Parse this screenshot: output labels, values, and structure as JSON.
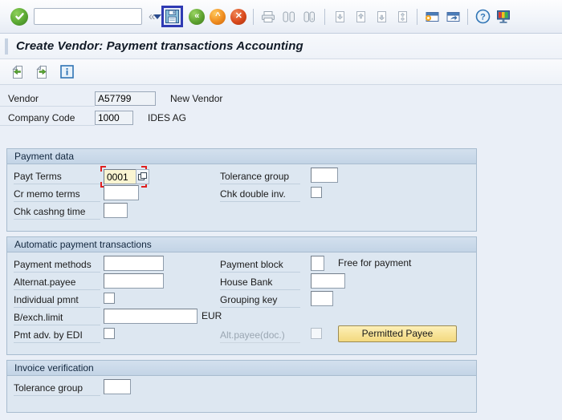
{
  "toolbar": {
    "ok_icon": "check-circle-icon",
    "command_value": "",
    "command_placeholder": "",
    "buttons": [
      {
        "name": "collapse-chevron-icon",
        "label": "«"
      },
      {
        "name": "save-icon",
        "label": "Save"
      },
      {
        "name": "back-icon",
        "label": "«"
      },
      {
        "name": "exit-icon",
        "label": "^"
      },
      {
        "name": "cancel-icon",
        "label": "×"
      },
      {
        "name": "print-icon",
        "label": "Print"
      },
      {
        "name": "find-icon",
        "label": "Find"
      },
      {
        "name": "find-next-icon",
        "label": "Find Next"
      },
      {
        "name": "first-page-icon",
        "label": "First Page"
      },
      {
        "name": "previous-page-icon",
        "label": "Previous Page"
      },
      {
        "name": "next-page-icon",
        "label": "Next Page"
      },
      {
        "name": "last-page-icon",
        "label": "Last Page"
      },
      {
        "name": "create-session-icon",
        "label": "Create Session"
      },
      {
        "name": "create-shortcut-icon",
        "label": "Create Shortcut"
      },
      {
        "name": "help-icon",
        "label": "Help"
      },
      {
        "name": "customize-layout-icon",
        "label": "Customize Local Layout"
      }
    ]
  },
  "title": "Create Vendor: Payment transactions Accounting",
  "app_toolbar": [
    {
      "name": "previous-screen-icon",
      "label": "Previous screen"
    },
    {
      "name": "next-screen-icon",
      "label": "Next screen"
    },
    {
      "name": "info-icon",
      "label": "Info"
    }
  ],
  "header": {
    "vendor_label": "Vendor",
    "vendor_value": "A57799",
    "vendor_desc": "New Vendor",
    "company_code_label": "Company Code",
    "company_code_value": "1000",
    "company_desc": "IDES AG"
  },
  "payment_data": {
    "title": "Payment data",
    "payt_terms_label": "Payt Terms",
    "payt_terms_value": "0001",
    "cr_memo_terms_label": "Cr memo terms",
    "cr_memo_terms_value": "",
    "chk_cashng_time_label": "Chk cashng time",
    "chk_cashng_time_value": "",
    "tolerance_group_label": "Tolerance group",
    "tolerance_group_value": "",
    "chk_double_inv_label": "Chk double inv.",
    "chk_double_inv_checked": false
  },
  "automatic_payment": {
    "title": "Automatic payment transactions",
    "payment_methods_label": "Payment methods",
    "payment_methods_value": "",
    "alternat_payee_label": "Alternat.payee",
    "alternat_payee_value": "",
    "individual_pmnt_label": "Individual pmnt",
    "individual_pmnt_checked": false,
    "bexch_limit_label": "B/exch.limit",
    "bexch_limit_value": "",
    "currency": "EUR",
    "pmt_adv_edi_label": "Pmt adv. by EDI",
    "pmt_adv_edi_checked": false,
    "payment_block_label": "Payment block",
    "payment_block_value": "",
    "payment_block_desc": "Free for payment",
    "house_bank_label": "House Bank",
    "house_bank_value": "",
    "grouping_key_label": "Grouping key",
    "grouping_key_value": "",
    "alt_payee_doc_label": "Alt.payee(doc.)",
    "alt_payee_doc_checked": false,
    "permitted_payee_button": "Permitted Payee"
  },
  "invoice_verification": {
    "title": "Invoice verification",
    "tolerance_group_label": "Tolerance group",
    "tolerance_group_value": ""
  },
  "colors": {
    "accent_blue": "#2f3ab3",
    "panel_bg": "#dde7f1",
    "panel_header": "#c3d4e6",
    "focus_red": "#e02020",
    "button_yellow": "#f8e49a",
    "focused_field_bg": "#faf5d2"
  }
}
